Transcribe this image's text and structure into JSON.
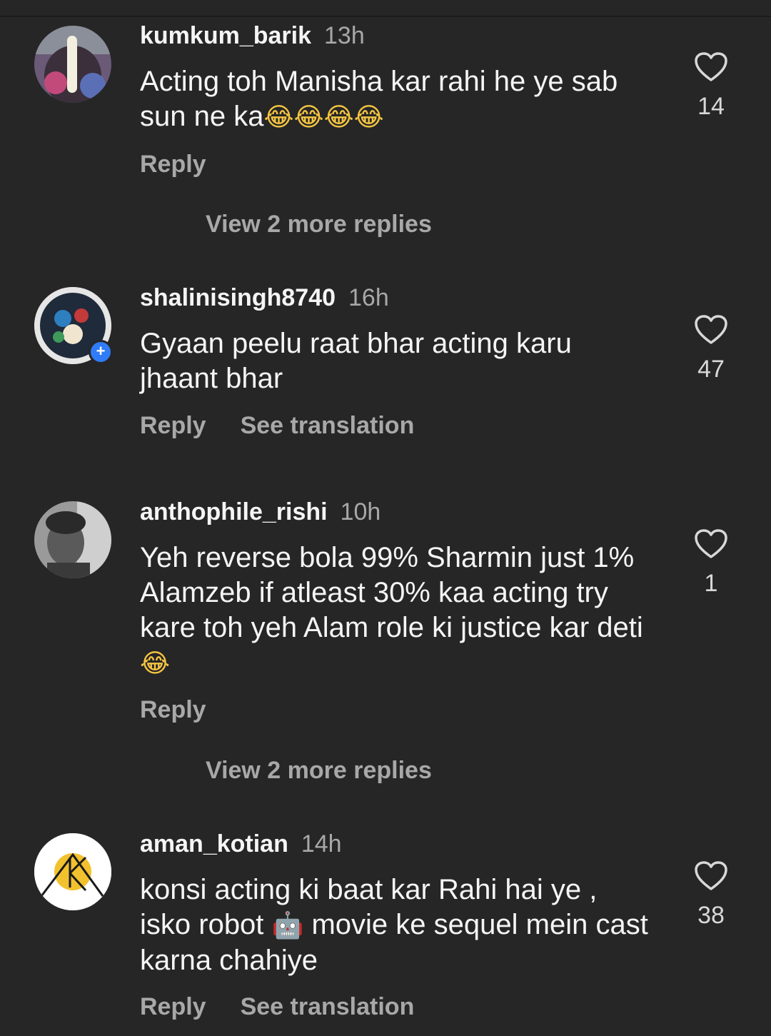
{
  "comments": [
    {
      "username": "kumkum_barik",
      "time": "13h",
      "text": "Acting toh Manisha kar rahi he ye sab sun ne ka",
      "emoji": "😂😂😂😂",
      "reply": "Reply",
      "translate": "",
      "likes": "14",
      "view_replies": "View 2 more replies"
    },
    {
      "username": "shalinisingh8740",
      "time": "16h",
      "text": "Gyaan peelu raat bhar acting karu jhaant bhar",
      "emoji": "",
      "reply": "Reply",
      "translate": "See translation",
      "likes": "47",
      "view_replies": ""
    },
    {
      "username": "anthophile_rishi",
      "time": "10h",
      "text": "Yeh reverse bola 99% Sharmin just 1% Alamzeb if atleast 30% kaa acting try kare toh yeh Alam role ki justice kar deti",
      "emoji": "😂",
      "reply": "Reply",
      "translate": "",
      "likes": "1",
      "view_replies": "View 2 more replies"
    },
    {
      "username": "aman_kotian",
      "time": "14h",
      "text_part1": "konsi acting ki baat kar Rahi hai ye , isko robot ",
      "robot_emoji": "🤖",
      "text_part2": " movie ke sequel mein cast karna chahiye",
      "reply": "Reply",
      "translate": "See translation",
      "likes": "38",
      "view_replies": ""
    }
  ],
  "colors": {
    "background": "#262626",
    "primary_text": "#f5f5f5",
    "secondary_text": "#a8a8a8"
  },
  "icons": {
    "like": "heart-outline-icon"
  }
}
